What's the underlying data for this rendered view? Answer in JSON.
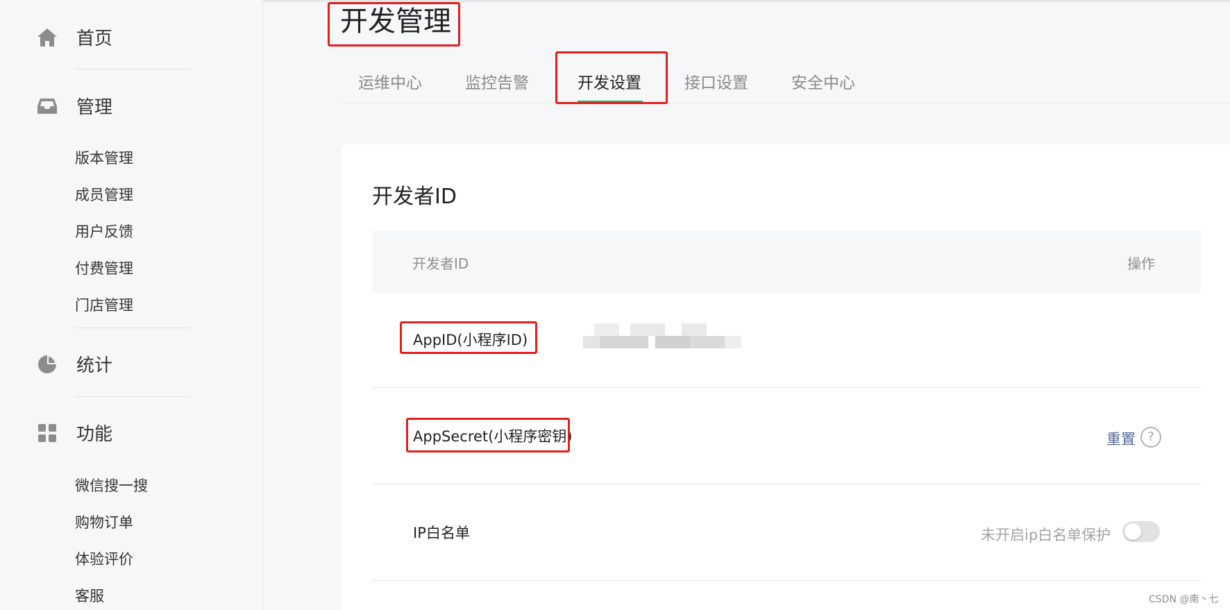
{
  "sidebar": {
    "home": {
      "label": "首页",
      "icon": "home-icon"
    },
    "manage": {
      "label": "管理",
      "icon": "inbox-icon",
      "items": [
        "版本管理",
        "成员管理",
        "用户反馈",
        "付费管理",
        "门店管理"
      ]
    },
    "stats": {
      "label": "统计",
      "icon": "pie-chart-icon"
    },
    "features": {
      "label": "功能",
      "icon": "grid-icon",
      "items": [
        "微信搜一搜",
        "购物订单",
        "体验评价",
        "客服"
      ]
    }
  },
  "page": {
    "title": "开发管理"
  },
  "tabs": [
    {
      "label": "运维中心",
      "active": false
    },
    {
      "label": "监控告警",
      "active": false
    },
    {
      "label": "开发设置",
      "active": true
    },
    {
      "label": "接口设置",
      "active": false
    },
    {
      "label": "安全中心",
      "active": false
    }
  ],
  "card": {
    "title": "开发者ID",
    "header": {
      "col1": "开发者ID",
      "col2": "操作"
    },
    "rows": [
      {
        "label": "AppID(小程序ID)"
      },
      {
        "label": "AppSecret(小程序密钥)",
        "action": "重置",
        "help": "?"
      },
      {
        "label": "IP白名单",
        "status": "未开启ip白名单保护",
        "toggle_on": false
      }
    ]
  },
  "colors": {
    "highlight": "#e31e1e",
    "link": "#576b95",
    "accent": "#07c160"
  },
  "watermark": "CSDN @南丶七"
}
